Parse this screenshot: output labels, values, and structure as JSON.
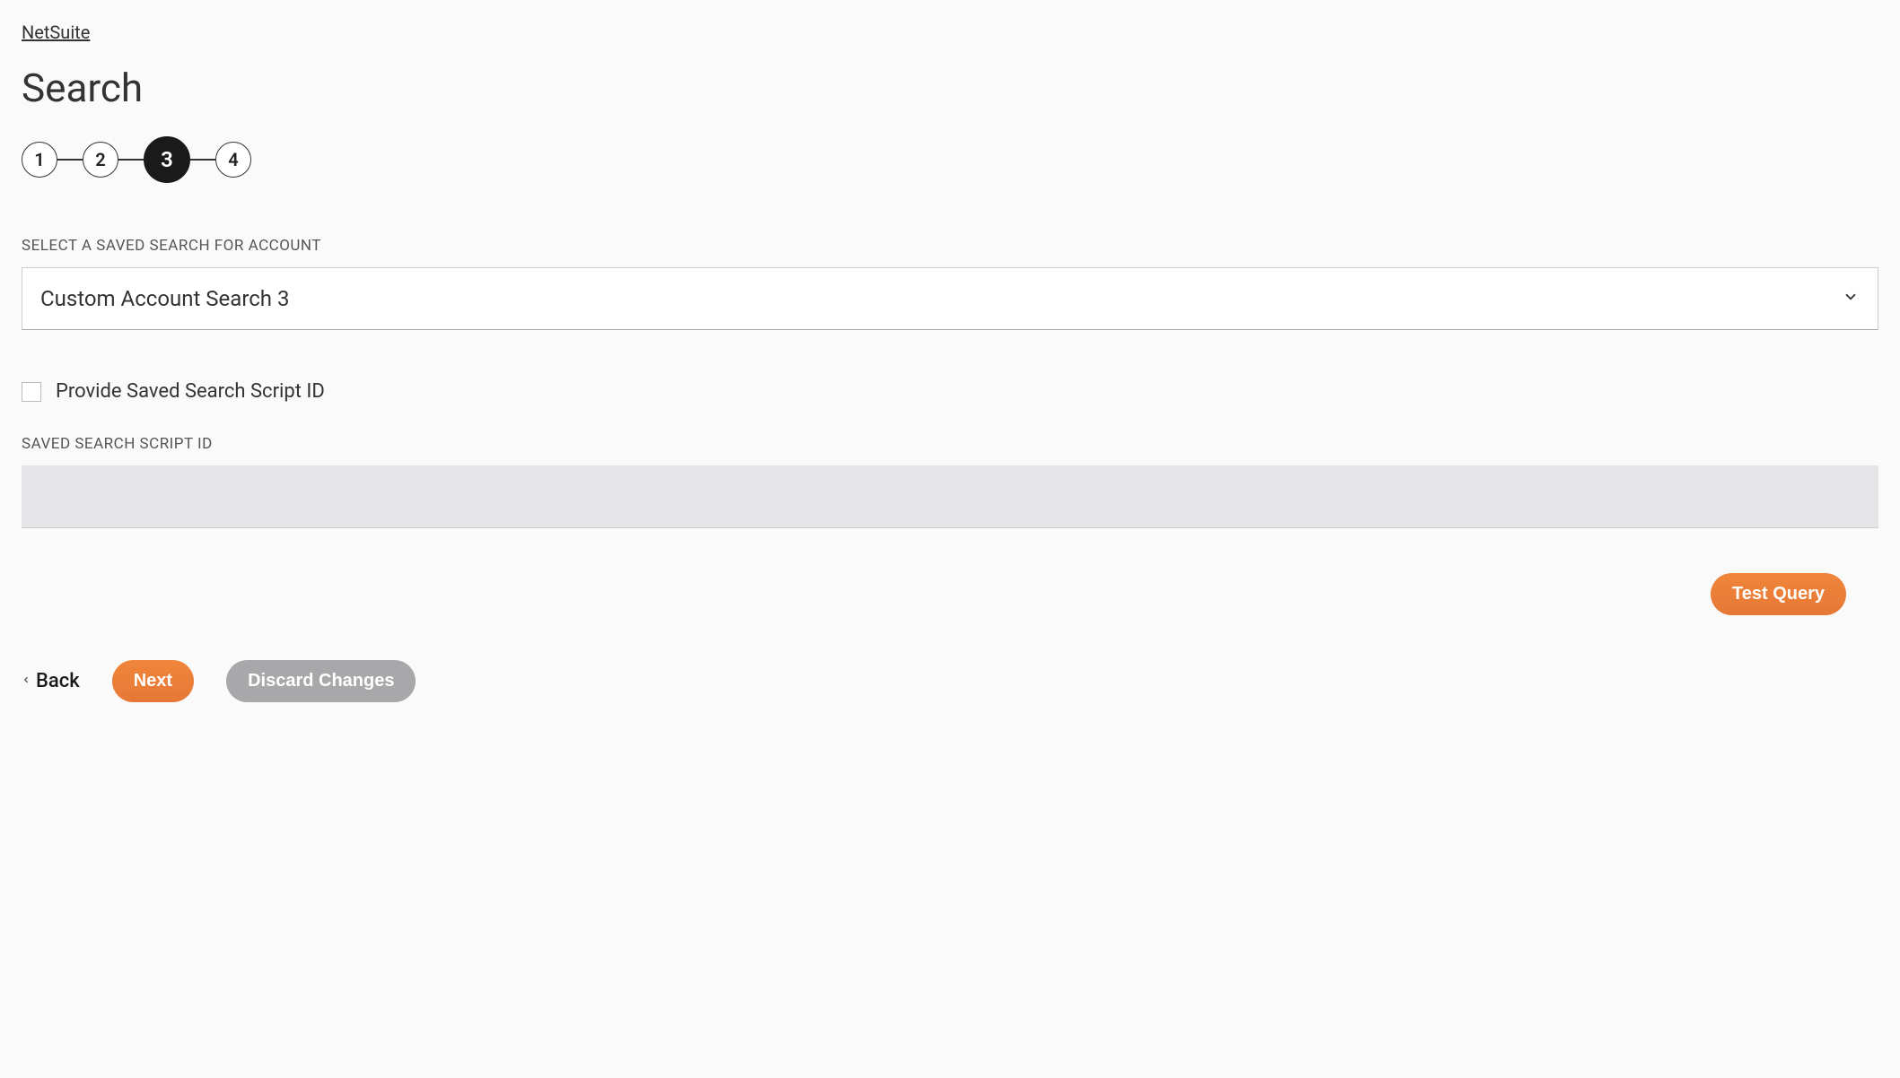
{
  "breadcrumb": "NetSuite",
  "pageTitle": "Search",
  "stepper": {
    "steps": [
      "1",
      "2",
      "3",
      "4"
    ],
    "activeIndex": 2
  },
  "form": {
    "savedSearchLabel": "SELECT A SAVED SEARCH FOR ACCOUNT",
    "savedSearchValue": "Custom Account Search 3",
    "checkboxLabel": "Provide Saved Search Script ID",
    "checkboxChecked": false,
    "scriptIdLabel": "SAVED SEARCH SCRIPT ID",
    "scriptIdValue": ""
  },
  "buttons": {
    "testQuery": "Test Query",
    "back": "Back",
    "next": "Next",
    "discard": "Discard Changes"
  }
}
